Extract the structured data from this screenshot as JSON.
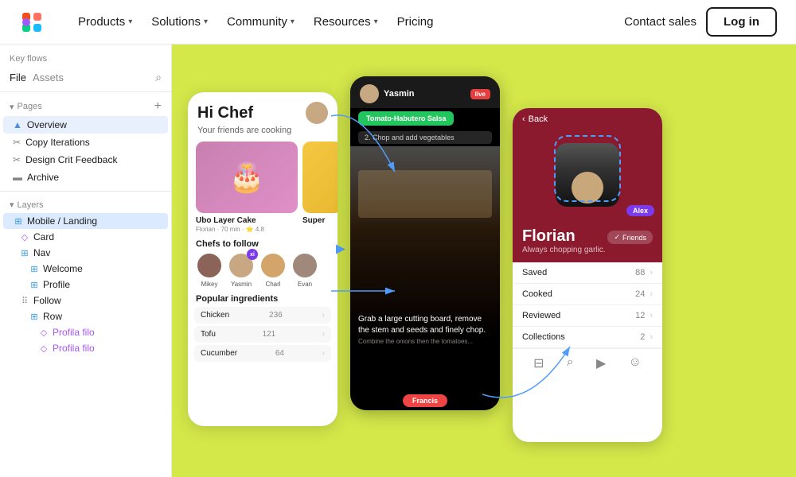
{
  "nav": {
    "logo_label": "Figma",
    "items": [
      {
        "label": "Products",
        "has_dropdown": true
      },
      {
        "label": "Solutions",
        "has_dropdown": true
      },
      {
        "label": "Community",
        "has_dropdown": true
      },
      {
        "label": "Resources",
        "has_dropdown": true
      },
      {
        "label": "Pricing",
        "has_dropdown": false
      }
    ],
    "contact_sales": "Contact sales",
    "login": "Log in"
  },
  "sidebar": {
    "keyflows_label": "Key flows",
    "file_tab": "File",
    "assets_tab": "Assets",
    "pages_section": "Pages",
    "pages": [
      {
        "icon": "▲",
        "label": "Overview",
        "active": true
      },
      {
        "icon": "✂",
        "label": "Copy Iterations"
      },
      {
        "icon": "✂",
        "label": "Design Crit Feedback"
      },
      {
        "icon": "🎬",
        "label": "Archive"
      }
    ],
    "layers_section": "Layers",
    "layers": [
      {
        "indent": 0,
        "icon": "⊞",
        "label": "Mobile / Landing",
        "selected": true
      },
      {
        "indent": 1,
        "icon": "◇",
        "label": "Card"
      },
      {
        "indent": 1,
        "icon": "⊞",
        "label": "Nav"
      },
      {
        "indent": 2,
        "icon": "⊞",
        "label": "Welcome"
      },
      {
        "indent": 2,
        "icon": "⊞",
        "label": "Profile"
      },
      {
        "indent": 1,
        "icon": "⊞",
        "label": "Follow"
      },
      {
        "indent": 2,
        "icon": "⊞",
        "label": "Row"
      },
      {
        "indent": 3,
        "icon": "◇",
        "label": "Profila filo",
        "purple": true
      },
      {
        "indent": 3,
        "icon": "◇",
        "label": "Profila filo",
        "purple": true
      }
    ]
  },
  "phone1": {
    "greeting": "Hi Chef",
    "friends_cooking": "Your friends are cooking",
    "cake_name": "Ubo Layer Cake",
    "cake_meta": "Florian · 70 min · ⭐ 4.8",
    "super_label": "Super",
    "chefs_title": "Chefs to follow",
    "chef_names": [
      "Mikey",
      "Yasmin",
      "Charl",
      "Evan"
    ],
    "ingredients_title": "Popular ingredients",
    "ingredients": [
      {
        "name": "Chicken",
        "count": "236"
      },
      {
        "name": "Tofu",
        "count": "121"
      },
      {
        "name": "Cucumber",
        "count": "64"
      }
    ]
  },
  "phone2": {
    "user_name": "Yasmin",
    "live_label": "live",
    "recipe_tag": "Tomato-Habutero Salsa",
    "step": "2. Chop and add vegetables",
    "caption": "Grab a large cutting board, remove the stem and seeds and finely chop.",
    "caption_sub": "Combine the onions then the tomatoes...",
    "francis_badge": "Francis"
  },
  "phone3": {
    "back_label": "Back",
    "user_name": "Florian",
    "tagline": "Always chopping garlic.",
    "friends_btn": "✓ Friends",
    "alex_badge": "Alex",
    "stats": [
      {
        "label": "Saved",
        "value": "88"
      },
      {
        "label": "Cooked",
        "value": "24"
      },
      {
        "label": "Reviewed",
        "value": "12"
      },
      {
        "label": "Collections",
        "value": "2"
      }
    ]
  },
  "colors": {
    "canvas_bg": "#d4e84a",
    "selection_blue": "#4f9cf9",
    "phone3_bg": "#8B1A2E",
    "purple": "#7C3AED",
    "live_red": "#e53e3e",
    "green": "#22c55e"
  }
}
